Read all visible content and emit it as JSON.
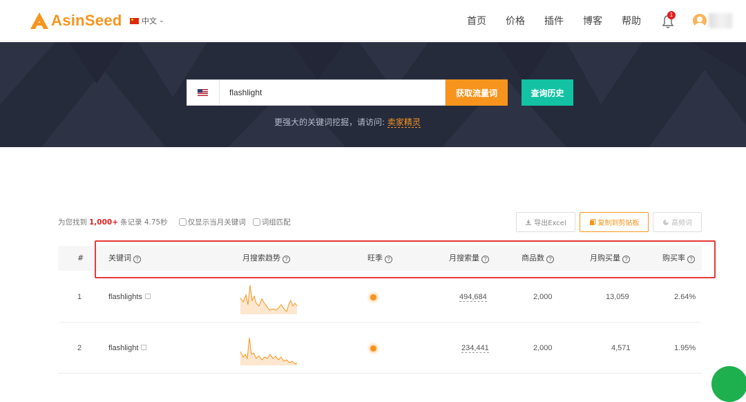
{
  "header": {
    "logo_text": "AsinSeed",
    "language": "中文",
    "nav": [
      "首页",
      "价格",
      "插件",
      "博客",
      "帮助"
    ],
    "notification_count": "1",
    "brand_color": "#f7941d"
  },
  "search": {
    "marketplace_icon": "us-flag-icon",
    "value": "flashlight",
    "get_button": "获取流量词",
    "history_button": "查询历史",
    "hint_text": "更强大的关键词挖掘，请访问:",
    "hint_link": "卖家精灵"
  },
  "results": {
    "prefix": "为您找到",
    "count": "1,000+",
    "suffix": "条记录 4.75秒",
    "filter_current_month": "仅显示当月关键词",
    "filter_phrase_match": "词组匹配",
    "export_label": "导出Excel",
    "copy_label": "复制到剪贴板",
    "high_freq_label": "高频词"
  },
  "table": {
    "headers": {
      "index": "#",
      "keyword": "关键词",
      "trend": "月搜索趋势",
      "season": "旺季",
      "searches": "月搜索量",
      "products": "商品数",
      "purchases": "月购买量",
      "purchase_rate": "购买率"
    },
    "rows": [
      {
        "index": "1",
        "keyword": "flashlights",
        "searches": "494,684",
        "products": "2,000",
        "purchases": "13,059",
        "purchase_rate": "2.64%"
      },
      {
        "index": "2",
        "keyword": "flashlight",
        "searches": "234,441",
        "products": "2,000",
        "purchases": "4,571",
        "purchase_rate": "1.95%"
      }
    ]
  }
}
